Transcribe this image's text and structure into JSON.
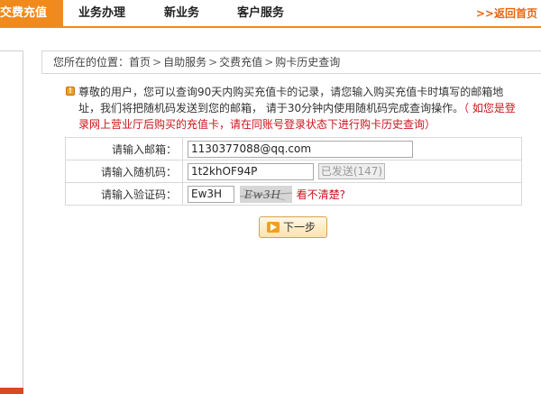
{
  "nav": {
    "active_tab": "交费充值",
    "tabs": [
      "业务办理",
      "新业务",
      "客户服务"
    ],
    "back_link": ">>返回首页"
  },
  "breadcrumb": {
    "prefix": "您所在的位置：",
    "items": [
      "首页",
      "自助服务",
      "交费充值",
      "购卡历史查询"
    ],
    "separator": ">"
  },
  "notice": {
    "text": "尊敬的用户，您可以查询90天内购买充值卡的记录，请您输入购买充值卡时填写的邮箱地址，我们将把随机码发送到您的邮箱， 请于30分钟内使用随机码完成查询操作。",
    "warning": "（ 如您是登录网上营业厅后购买的充值卡，请在同账号登录状态下进行购卡历史查询）"
  },
  "form": {
    "email_label": "请输入邮箱：",
    "email_value": "1130377088@qq.com",
    "random_label": "请输入随机码：",
    "random_value": "1t2khOF94P",
    "sent_button": "已发送(147)",
    "captcha_label": "请输入验证码：",
    "captcha_value": "Ew3H",
    "captcha_image_text": "Ew3H",
    "unclear_link": "看不清楚?"
  },
  "next_button": "下一步",
  "colors": {
    "accent": "#f08a1d",
    "warning_red": "#c8161d"
  }
}
